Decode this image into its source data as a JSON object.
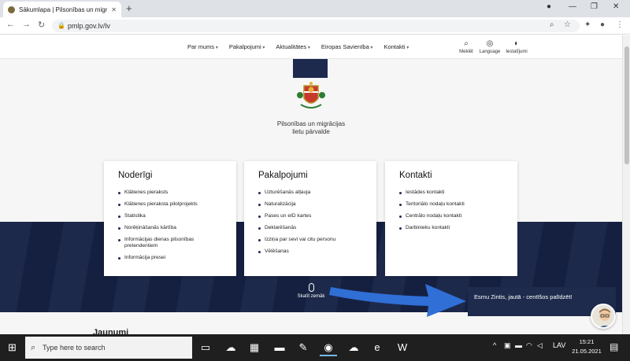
{
  "browser": {
    "tab_title": "Sākumlapa | Pilsonības un migrā",
    "tab_close": "✕",
    "new_tab": "+",
    "url": "pmlp.gov.lv/lv",
    "back": "←",
    "forward": "→",
    "reload": "↻",
    "minimize": "—",
    "restore": "❐",
    "close": "✕"
  },
  "site": {
    "menu": [
      "Par mums",
      "Pakalpojumi",
      "Aktualitātes",
      "Eiropas Savienība",
      "Kontakti"
    ],
    "tools": [
      {
        "label": "Meklēt",
        "icon": "search-icon"
      },
      {
        "label": "Language",
        "icon": "globe-icon"
      },
      {
        "label": "Iestatījumi",
        "icon": "settings-icon"
      }
    ],
    "org_name_line1": "Pilsonības un migrācijas",
    "org_name_line2": "lietu pārvalde"
  },
  "cards": [
    {
      "title": "Noderīgi",
      "items": [
        "Klātienes pieraksts",
        "Klātienes pieraksta pilotprojekts",
        "Statistika",
        "Norēķināšanās kārtība",
        "Informācijas dienas pilsonības pretendentiem",
        "Informācija presei"
      ]
    },
    {
      "title": "Pakalpojumi",
      "items": [
        "Uzturēšanās atļauja",
        "Naturalizācija",
        "Pases un eID kartes",
        "Deklarēšanās",
        "Izziņa par sevi vai citu personu",
        "Vēlēšanas"
      ]
    },
    {
      "title": "Kontakti",
      "items": [
        "Iestādes kontakti",
        "Teritoriālo nodaļu kontakti",
        "Centrālo nodaļu kontakti",
        "Darbinieku kontakti"
      ]
    }
  ],
  "scroll_down_label": "Skatīt zemāk",
  "news_heading": "Jaunumi",
  "chat": {
    "message": "Esmu Zintis, jautā - centīšos palīdzēt!"
  },
  "colors": {
    "navy": "#1d2a4d",
    "arrow": "#2f6fd6"
  },
  "taskbar": {
    "search_placeholder": "Type here to search",
    "language": "LAV",
    "time": "15:21",
    "date": "21.05.2021",
    "apps": [
      "task-view-icon",
      "weather-app-icon",
      "calculator-icon",
      "file-explorer-icon",
      "notes-app-icon",
      "chrome-icon",
      "cloud-app-icon",
      "edge-icon",
      "word-icon"
    ]
  }
}
